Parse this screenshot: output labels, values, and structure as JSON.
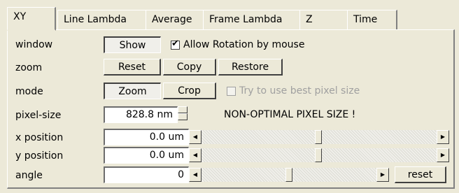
{
  "tabs": [
    {
      "label": "XY",
      "active": true
    },
    {
      "label": "Line Lambda",
      "active": false
    },
    {
      "label": "Average",
      "active": false
    },
    {
      "label": "Frame Lambda",
      "active": false
    },
    {
      "label": "Z",
      "active": false
    },
    {
      "label": "Time",
      "active": false
    }
  ],
  "window_row": {
    "label": "window",
    "show_button": "Show",
    "show_pressed": true,
    "allow_rotation_label": "Allow Rotation by mouse",
    "allow_rotation_checked": true
  },
  "zoom_row": {
    "label": "zoom",
    "reset_button": "Reset",
    "copy_button": "Copy",
    "restore_button": "Restore"
  },
  "mode_row": {
    "label": "mode",
    "zoom_button": "Zoom",
    "zoom_pressed": true,
    "crop_button": "Crop",
    "best_pixel_label": "Try to use best pixel size",
    "best_pixel_checked": false,
    "best_pixel_enabled": false
  },
  "pixel_size_row": {
    "label": "pixel-size",
    "value": "828.8 nm",
    "warning": "NON-OPTIMAL PIXEL SIZE !"
  },
  "x_position_row": {
    "label": "x position",
    "value": "0.0 um",
    "slider_fraction": 0.5
  },
  "y_position_row": {
    "label": "y position",
    "value": "0.0 um",
    "slider_fraction": 0.5
  },
  "angle_row": {
    "label": "angle",
    "value": "0",
    "slider_fraction": 0.5,
    "reset_button": "reset"
  }
}
